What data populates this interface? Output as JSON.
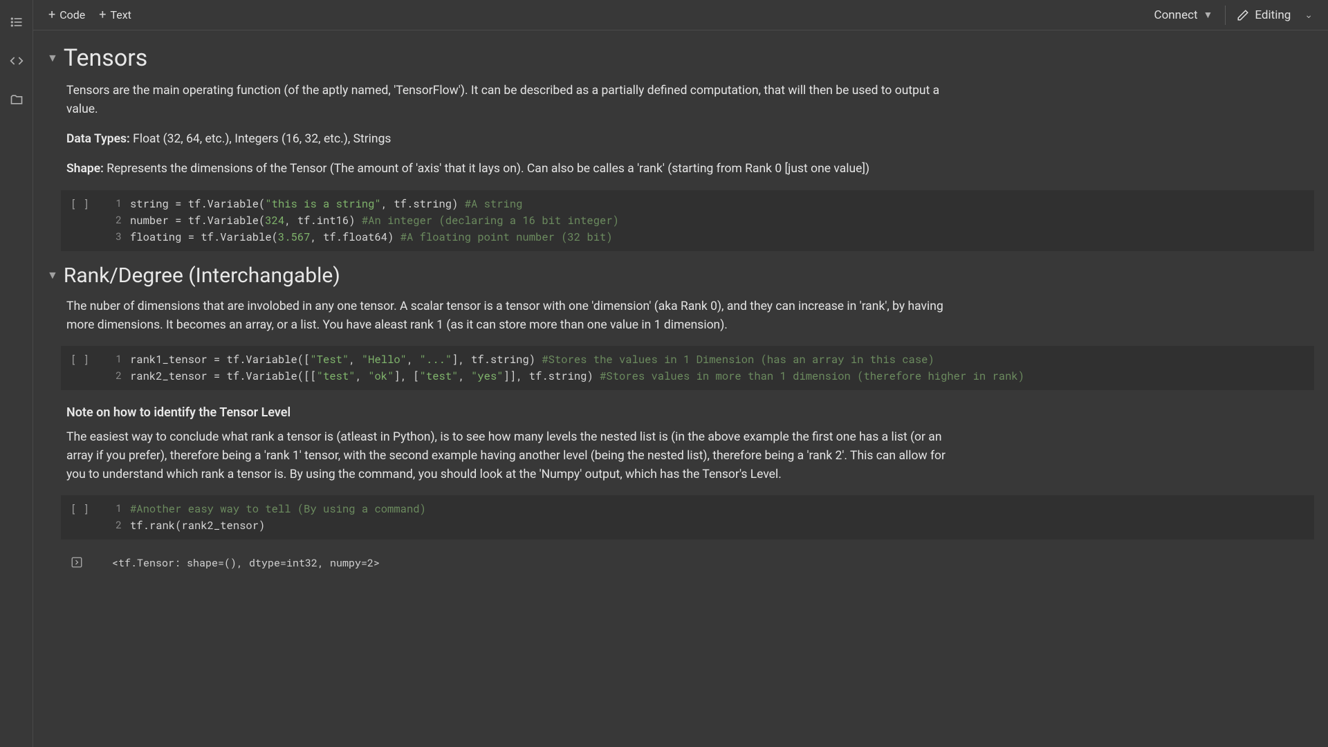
{
  "sidebar": {
    "icons": {
      "toc": "table-of-contents",
      "code": "code-snippets",
      "files": "files"
    }
  },
  "topbar": {
    "code_label": "Code",
    "text_label": "Text",
    "connect_label": "Connect",
    "editing_label": "Editing"
  },
  "sections": [
    {
      "title": "Tensors",
      "paragraphs": [
        {
          "type": "p",
          "html": "Tensors are the main operating function (of the aptly named, 'TensorFlow'). It can be described as a partially defined computation, that will then be used to output a value."
        },
        {
          "type": "p_strong",
          "strong": "Data Types:",
          "rest": " Float (32, 64, etc.), Integers (16, 32, etc.), Strings"
        },
        {
          "type": "p_strong",
          "strong": "Shape:",
          "rest": " Represents the dimensions of the Tensor (The amount of 'axis' that it lays on). Can also be calles a 'rank' (starting from Rank 0 [just one value])"
        }
      ],
      "cell": {
        "gutter": "[ ]",
        "lines": [
          {
            "n": "1",
            "code": [
              {
                "c": "tok-var",
                "t": "string"
              },
              {
                "c": "tok-op",
                "t": " = "
              },
              {
                "c": "tok-call",
                "t": "tf.Variable("
              },
              {
                "c": "tok-str",
                "t": "\"this is a string\""
              },
              {
                "c": "tok-call",
                "t": ", tf.string) "
              },
              {
                "c": "tok-comment",
                "t": "#A string"
              }
            ]
          },
          {
            "n": "2",
            "code": [
              {
                "c": "tok-var",
                "t": "number"
              },
              {
                "c": "tok-op",
                "t": " = "
              },
              {
                "c": "tok-call",
                "t": "tf.Variable("
              },
              {
                "c": "tok-num",
                "t": "324"
              },
              {
                "c": "tok-call",
                "t": ", tf.int16) "
              },
              {
                "c": "tok-comment",
                "t": "#An integer (declaring a 16 bit integer)"
              }
            ]
          },
          {
            "n": "3",
            "code": [
              {
                "c": "tok-var",
                "t": "floating"
              },
              {
                "c": "tok-op",
                "t": " = "
              },
              {
                "c": "tok-call",
                "t": "tf.Variable("
              },
              {
                "c": "tok-num",
                "t": "3.567"
              },
              {
                "c": "tok-call",
                "t": ", tf.float64) "
              },
              {
                "c": "tok-comment",
                "t": "#A floating point number (32 bit)"
              }
            ]
          }
        ]
      }
    },
    {
      "title": "Rank/Degree (Interchangable)",
      "paragraphs": [
        {
          "type": "p",
          "html": "The nuber of dimensions that are involobed in any one tensor. A scalar tensor is a tensor with one 'dimension' (aka Rank 0), and they can increase in 'rank', by having more dimensions. It becomes an array, or a list. You have aleast rank 1 (as it can store more than one value in 1 dimension)."
        }
      ],
      "cell": {
        "gutter": "[ ]",
        "lines": [
          {
            "n": "1",
            "code": [
              {
                "c": "tok-var",
                "t": "rank1_tensor"
              },
              {
                "c": "tok-op",
                "t": " = "
              },
              {
                "c": "tok-call",
                "t": "tf.Variable(["
              },
              {
                "c": "tok-str",
                "t": "\"Test\""
              },
              {
                "c": "tok-call",
                "t": ", "
              },
              {
                "c": "tok-str",
                "t": "\"Hello\""
              },
              {
                "c": "tok-call",
                "t": ", "
              },
              {
                "c": "tok-str",
                "t": "\"...\""
              },
              {
                "c": "tok-call",
                "t": "], tf.string) "
              },
              {
                "c": "tok-comment",
                "t": "#Stores the values in 1 Dimension (has an array in this case)"
              }
            ]
          },
          {
            "n": "2",
            "code": [
              {
                "c": "tok-var",
                "t": "rank2_tensor"
              },
              {
                "c": "tok-op",
                "t": " = "
              },
              {
                "c": "tok-call",
                "t": "tf.Variable([["
              },
              {
                "c": "tok-str",
                "t": "\"test\""
              },
              {
                "c": "tok-call",
                "t": ", "
              },
              {
                "c": "tok-str",
                "t": "\"ok\""
              },
              {
                "c": "tok-call",
                "t": "], ["
              },
              {
                "c": "tok-str",
                "t": "\"test\""
              },
              {
                "c": "tok-call",
                "t": ", "
              },
              {
                "c": "tok-str",
                "t": "\"yes\""
              },
              {
                "c": "tok-call",
                "t": "]], tf.string) "
              },
              {
                "c": "tok-comment",
                "t": "#Stores values in more than 1 dimension (therefore higher in rank)"
              }
            ]
          }
        ]
      },
      "subheader": "Note on how to identify the Tensor Level",
      "paragraphs2": [
        {
          "type": "p",
          "html": "The easiest way to conclude what rank a tensor is (atleast in Python), is to see how many levels the nested list is (in the above example the first one has a list (or an array if you prefer), therefore being a 'rank 1' tensor, with the second example having another level (being the nested list), therefore being a 'rank 2'. This can allow for you to understand which rank a tensor is. By using the command, you should look at the 'Numpy' output, which has the Tensor's Level."
        }
      ],
      "cell2": {
        "gutter": "[ ]",
        "lines": [
          {
            "n": "1",
            "code": [
              {
                "c": "tok-comment",
                "t": "#Another easy way to tell (By using a command)"
              }
            ]
          },
          {
            "n": "2",
            "code": [
              {
                "c": "tok-call",
                "t": "tf.rank(rank2_tensor)"
              }
            ]
          }
        ]
      },
      "output": "<tf.Tensor: shape=(), dtype=int32, numpy=2>"
    }
  ]
}
